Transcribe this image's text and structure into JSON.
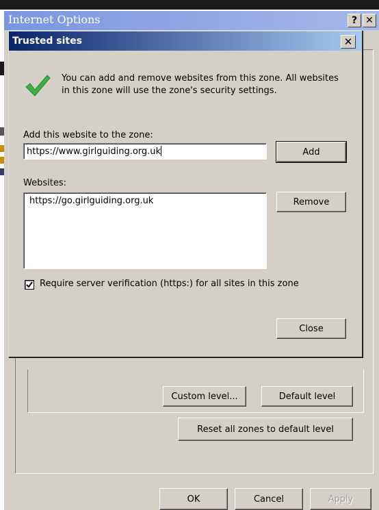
{
  "outer_window": {
    "title": "Internet Options",
    "help_glyph": "?",
    "close_glyph": "✕",
    "buttons": {
      "custom_level": "Custom level...",
      "default_level": "Default level",
      "reset_all": "Reset all zones to default level",
      "ok": "OK",
      "cancel": "Cancel",
      "apply": "Apply"
    }
  },
  "dialog": {
    "title": "Trusted sites",
    "close_glyph": "✕",
    "intro_icon": "checkmark-icon",
    "intro_text": "You can add and remove websites from this zone. All websites in this zone will use the zone's security settings.",
    "add_label": "Add this website to the zone:",
    "add_value": "https://www.girlguiding.org.uk",
    "add_button": "Add",
    "websites_label": "Websites:",
    "websites": [
      "https://go.girlguiding.org.uk"
    ],
    "remove_button": "Remove",
    "require_verification_label": "Require server verification (https:) for all sites in this zone",
    "require_verification_checked": true,
    "close_button": "Close"
  },
  "colors": {
    "dialog_face": "#d4d0c8",
    "active_title_start": "#0a246a",
    "active_title_end": "#a6caf0",
    "inactive_title_start": "#7a96df",
    "inactive_title_end": "#a6b8e8",
    "check_green": "#3cb043"
  }
}
